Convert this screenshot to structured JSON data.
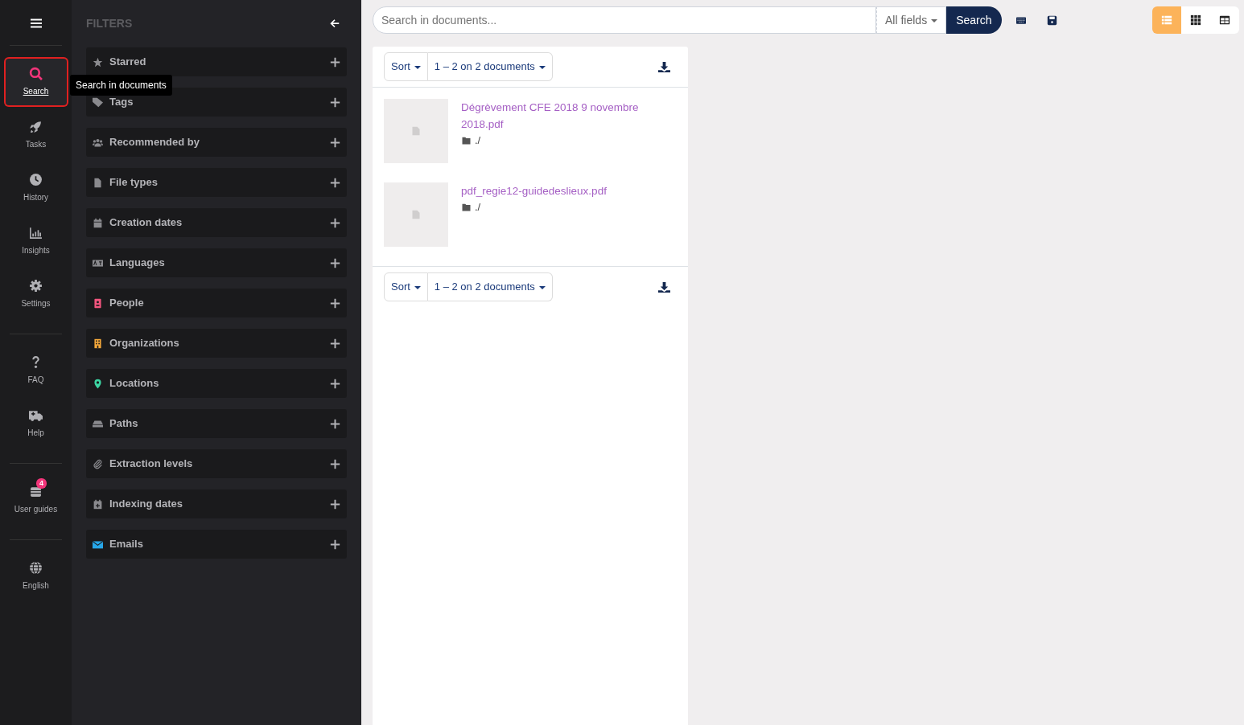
{
  "nav": {
    "groups": [
      [
        {
          "label": "Search",
          "selected": true,
          "highlighted": true
        },
        {
          "label": "Tasks",
          "selected": false,
          "highlighted": false
        },
        {
          "label": "History",
          "selected": false,
          "highlighted": false
        },
        {
          "label": "Insights",
          "selected": false,
          "highlighted": false
        },
        {
          "label": "Settings",
          "selected": false,
          "highlighted": false
        }
      ],
      [
        {
          "label": "FAQ",
          "selected": false,
          "highlighted": false
        },
        {
          "label": "Help",
          "selected": false,
          "highlighted": false
        }
      ],
      [
        {
          "label": "User guides",
          "selected": false,
          "highlighted": false,
          "badge": "4"
        }
      ],
      [
        {
          "label": "English",
          "selected": false,
          "highlighted": false
        }
      ]
    ]
  },
  "tooltip": "Search in documents",
  "filters": {
    "title": "FILTERS",
    "items": [
      {
        "label": "Starred",
        "color": "#8a8a8e"
      },
      {
        "label": "Tags",
        "color": "#8a8a8e"
      },
      {
        "label": "Recommended by",
        "color": "#8a8a8e"
      },
      {
        "label": "File types",
        "color": "#8a8a8e"
      },
      {
        "label": "Creation dates",
        "color": "#8a8a8e"
      },
      {
        "label": "Languages",
        "color": "#8a8a8e"
      },
      {
        "label": "People",
        "color": "#f2557e"
      },
      {
        "label": "Organizations",
        "color": "#f6a93b"
      },
      {
        "label": "Locations",
        "color": "#3dd6a3"
      },
      {
        "label": "Paths",
        "color": "#8a8a8e"
      },
      {
        "label": "Extraction levels",
        "color": "#8a8a8e"
      },
      {
        "label": "Indexing dates",
        "color": "#8a8a8e"
      },
      {
        "label": "Emails",
        "color": "#27a6e8"
      }
    ]
  },
  "search": {
    "placeholder": "Search in documents...",
    "field": "All fields",
    "button": "Search"
  },
  "views": [
    {
      "selected": true
    },
    {
      "selected": false
    },
    {
      "selected": false
    }
  ],
  "results": {
    "toolbars": [
      {
        "sort": "Sort",
        "range": "1 – 2 on 2 documents"
      },
      {
        "sort": "Sort",
        "range": "1 – 2 on 2 documents"
      }
    ],
    "documents": [
      {
        "name": "Dégrèvement CFE 2018 9 novembre 2018.pdf",
        "path": "./"
      },
      {
        "name": "pdf_regie12-guidedeslieux.pdf",
        "path": "./"
      }
    ]
  }
}
